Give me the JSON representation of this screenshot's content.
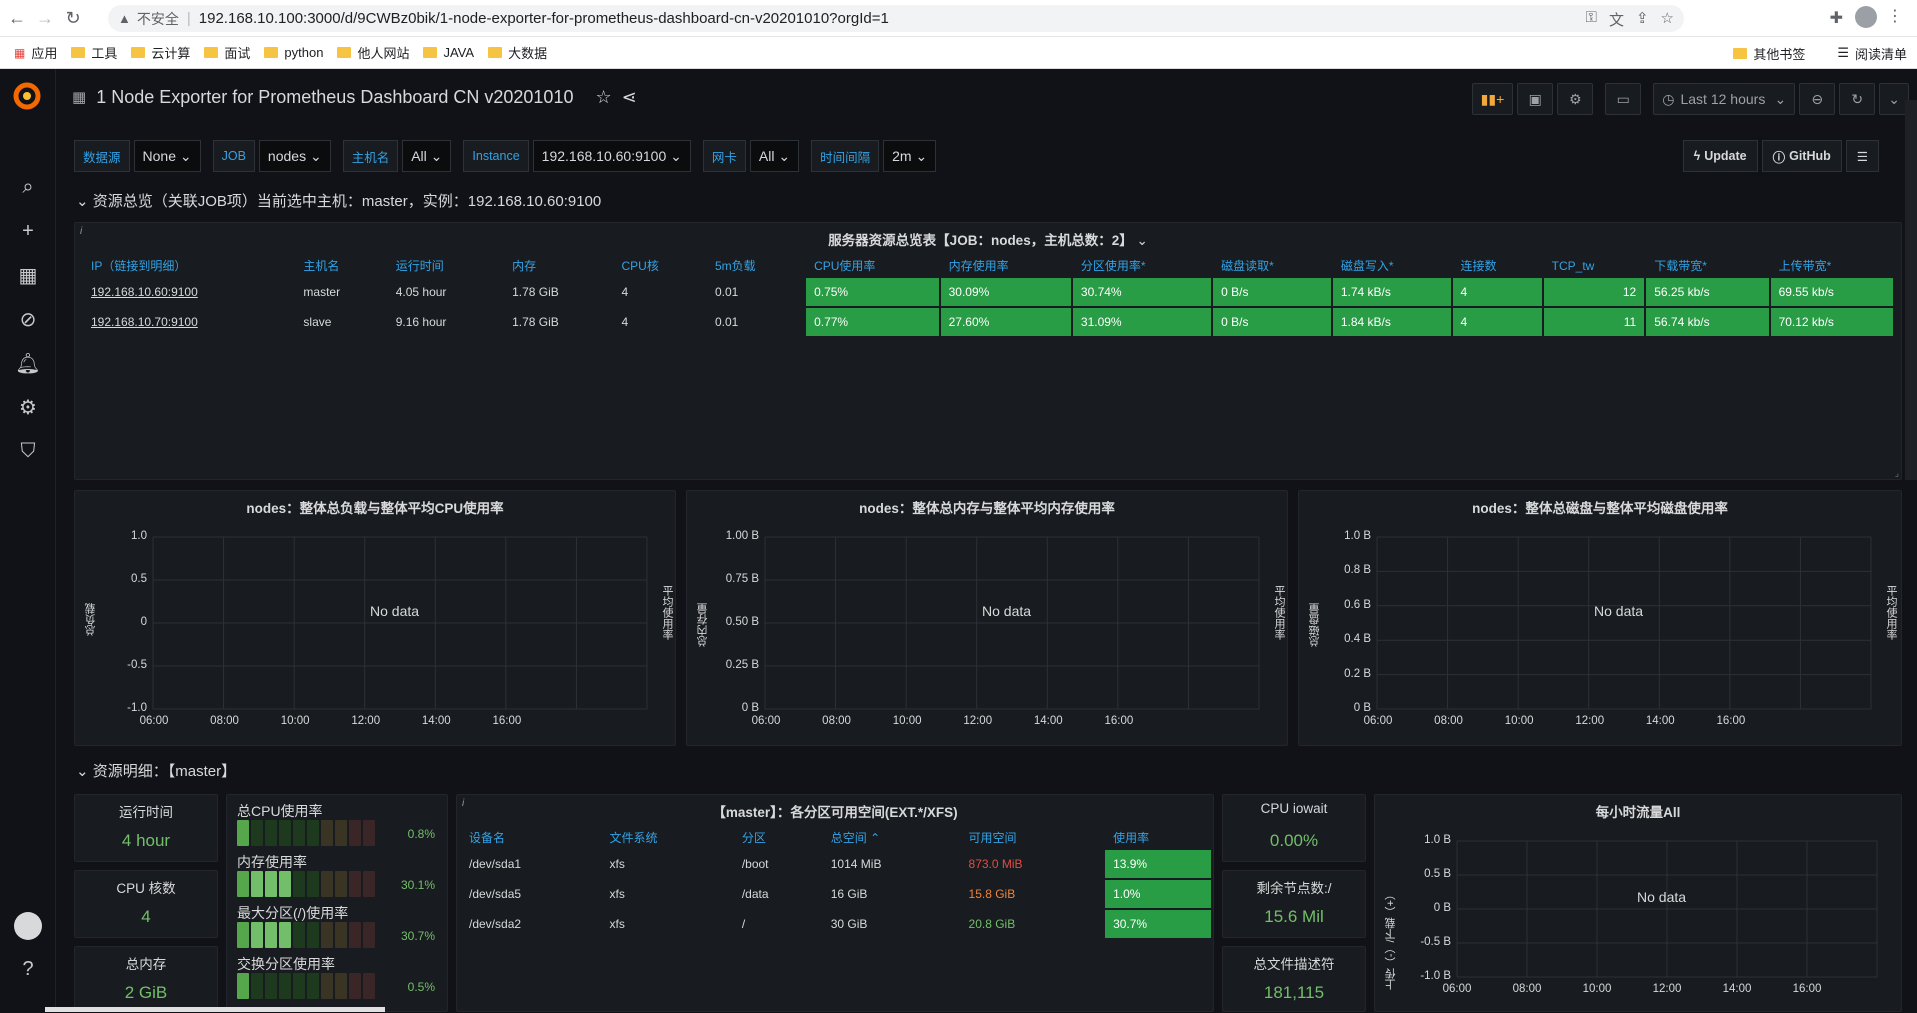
{
  "browser": {
    "insecure": "不安全",
    "url": "192.168.10.100:3000/d/9CWBz0bik/1-node-exporter-for-prometheus-dashboard-cn-v20201010?orgId=1",
    "bookmarks": [
      "应用",
      "工具",
      "云计算",
      "面试",
      "python",
      "他人网站",
      "JAVA",
      "大数据"
    ],
    "bookmarks_right": [
      "其他书签",
      "阅读清单"
    ]
  },
  "dashboard": {
    "title": "1 Node Exporter for Prometheus Dashboard CN v20201010",
    "time_range": "Last 12 hours"
  },
  "vars": [
    {
      "label": "数据源",
      "value": "None"
    },
    {
      "label": "JOB",
      "value": "nodes"
    },
    {
      "label": "主机名",
      "value": "All"
    },
    {
      "label": "Instance",
      "value": "192.168.10.60:9100"
    },
    {
      "label": "网卡",
      "value": "All"
    },
    {
      "label": "时间间隔",
      "value": "2m"
    }
  ],
  "links": {
    "update": "Update",
    "github": "GitHub"
  },
  "row1": {
    "title": "资源总览（关联JOB项）当前选中主机：master，实例：192.168.10.60:9100"
  },
  "overview_panel": {
    "title": "服务器资源总览表【JOB：nodes，主机总数：2】",
    "headers": [
      "IP（链接到明细）",
      "主机名",
      "运行时间",
      "内存",
      "CPU核",
      "5m负载",
      "CPU使用率",
      "内存使用率",
      "分区使用率*",
      "磁盘读取*",
      "磁盘写入*",
      "连接数",
      "TCP_tw",
      "下载带宽*",
      "上传带宽*"
    ],
    "rows": [
      [
        "192.168.10.60:9100",
        "master",
        "4.05 hour",
        "1.78 GiB",
        "4",
        "0.01",
        "0.75%",
        "30.09%",
        "30.74%",
        "0 B/s",
        "1.74 kB/s",
        "4",
        "12",
        "56.25 kb/s",
        "69.55 kb/s"
      ],
      [
        "192.168.10.70:9100",
        "slave",
        "9.16 hour",
        "1.78 GiB",
        "4",
        "0.01",
        "0.77%",
        "27.60%",
        "31.09%",
        "0 B/s",
        "1.84 kB/s",
        "4",
        "11",
        "56.74 kb/s",
        "70.12 kb/s"
      ]
    ]
  },
  "charts": [
    {
      "title": "nodes：整体总负载与整体平均CPU使用率",
      "yticks": [
        "1.0",
        "0.5",
        "0",
        "-0.5",
        "-1.0"
      ],
      "ylabel": "总负载",
      "y2label": "平均使用率",
      "nodata": "No data"
    },
    {
      "title": "nodes：整体总内存与整体平均内存使用率",
      "yticks": [
        "1.00 B",
        "0.75 B",
        "0.50 B",
        "0.25 B",
        "0 B"
      ],
      "ylabel": "总内存量",
      "y2label": "平均使用率",
      "nodata": "No data"
    },
    {
      "title": "nodes：整体总磁盘与整体平均磁盘使用率",
      "yticks": [
        "1.0 B",
        "0.8 B",
        "0.6 B",
        "0.4 B",
        "0.2 B",
        "0 B"
      ],
      "ylabel": "总磁盘量",
      "y2label": "平均使用率",
      "nodata": "No data"
    }
  ],
  "xticks": [
    "06:00",
    "08:00",
    "10:00",
    "12:00",
    "14:00",
    "16:00"
  ],
  "row2": {
    "title": "资源明细：【master】"
  },
  "stats": [
    {
      "title": "运行时间",
      "value": "4 hour"
    },
    {
      "title": "CPU 核数",
      "value": "4"
    },
    {
      "title": "总内存",
      "value": "2 GiB"
    }
  ],
  "bargauge": [
    {
      "label": "总CPU使用率",
      "pct": "0.8%",
      "fill": 0.008
    },
    {
      "label": "内存使用率",
      "pct": "30.1%",
      "fill": 0.301
    },
    {
      "label": "最大分区(/)使用率",
      "pct": "30.7%",
      "fill": 0.307
    },
    {
      "label": "交换分区使用率",
      "pct": "0.5%",
      "fill": 0.005
    }
  ],
  "fs_panel": {
    "title": "【master】：各分区可用空间(EXT.*/XFS)",
    "headers": [
      "设备名",
      "文件系统",
      "分区",
      "总空间",
      "可用空间",
      "使用率"
    ],
    "rows": [
      [
        "/dev/sda1",
        "xfs",
        "/boot",
        "1014 MiB",
        "873.0 MiB",
        "13.9%"
      ],
      [
        "/dev/sda5",
        "xfs",
        "/data",
        "16 GiB",
        "15.8 GiB",
        "1.0%"
      ],
      [
        "/dev/sda2",
        "xfs",
        "/",
        "30 GiB",
        "20.8 GiB",
        "30.7%"
      ]
    ],
    "avail_colors": [
      "#e24d42",
      "#ef843c",
      "#73bf69"
    ]
  },
  "small_stats": [
    {
      "title": "CPU iowait",
      "value": "0.00%"
    },
    {
      "title": "剩余节点数:/",
      "value": "15.6 Mil"
    },
    {
      "title": "总文件描述符",
      "value": "181,115"
    }
  ],
  "traffic": {
    "title": "每小时流量All",
    "yticks": [
      "1.0 B",
      "0.5 B",
      "0 B",
      "-0.5 B",
      "-1.0 B"
    ],
    "ylabel": "上传（-）/下载（+）",
    "xticks": [
      "06:00",
      "08:00",
      "10:00",
      "12:00",
      "14:00",
      "16:00"
    ],
    "nodata": "No data"
  },
  "colors": {
    "green": "#299c46",
    "stat_green": "#73bf69",
    "blue_label": "#33a2e5"
  }
}
